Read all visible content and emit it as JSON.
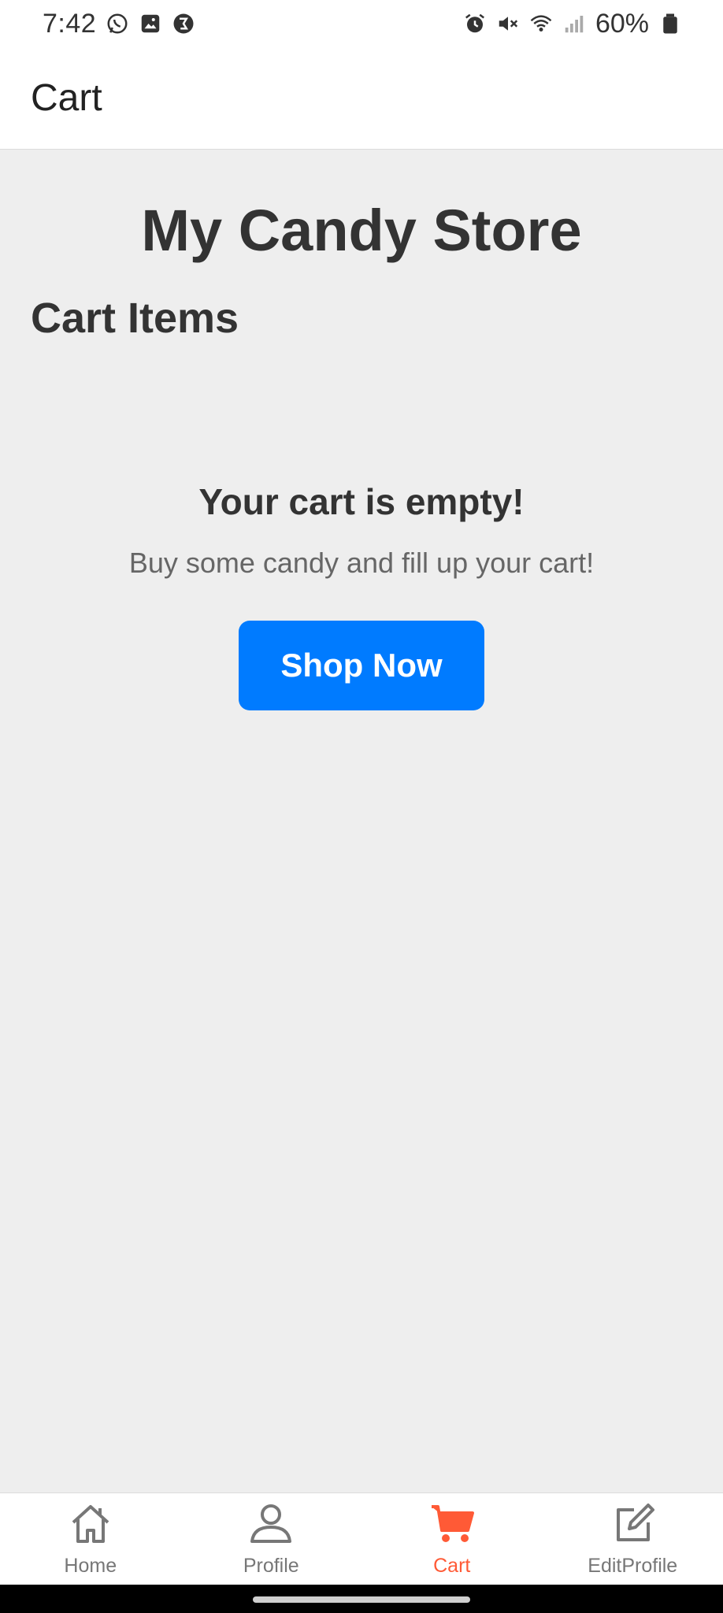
{
  "status_bar": {
    "time": "7:42",
    "left_icons": [
      "whatsapp-icon",
      "gallery-icon",
      "vpn-icon"
    ],
    "right_icons": [
      "alarm-icon",
      "mute-icon",
      "wifi-icon",
      "signal-icon",
      "battery-icon"
    ],
    "battery": "60%"
  },
  "header": {
    "title": "Cart"
  },
  "main": {
    "store_title": "My Candy Store",
    "section_title": "Cart Items",
    "empty_title": "Your cart is empty!",
    "empty_subtitle": "Buy some candy and fill up your cart!",
    "shop_button": "Shop Now"
  },
  "bottom_nav": {
    "active": "Cart",
    "active_color": "#ff5a36",
    "items": [
      {
        "label": "Home",
        "icon": "home-icon"
      },
      {
        "label": "Profile",
        "icon": "profile-icon"
      },
      {
        "label": "Cart",
        "icon": "cart-icon"
      },
      {
        "label": "EditProfile",
        "icon": "edit-icon"
      }
    ]
  },
  "colors": {
    "accent_button": "#007bff",
    "background": "#eeeeee"
  }
}
